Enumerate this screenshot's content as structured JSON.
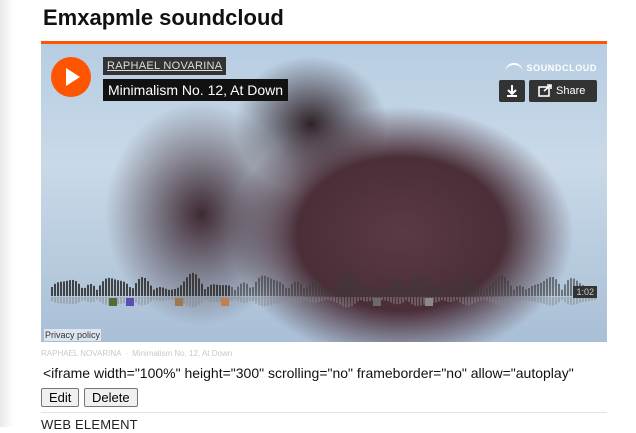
{
  "page": {
    "title": "Emxapmle soundcloud"
  },
  "player": {
    "artist": "RAPHAEL NOVARINA",
    "track": "Minimalism No. 12, At Down",
    "brand": "SOUNDCLOUD",
    "share_label": "Share",
    "duration": "1:02",
    "privacy": "Privacy policy",
    "accent_color": "#ff5500",
    "icons": {
      "play": "play-icon",
      "download": "download-icon",
      "share": "share-icon",
      "logo": "soundcloud-logo-icon"
    }
  },
  "caption": {
    "artist": "RAPHAEL NOVARINA",
    "separator": "·",
    "track": "Minimalism No. 12, At Down"
  },
  "embed_code": "<iframe width=\"100%\" height=\"300\" scrolling=\"no\" frameborder=\"no\" allow=\"autoplay\"",
  "buttons": {
    "edit": "Edit",
    "delete": "Delete"
  },
  "next_section": {
    "heading": "WEB ELEMENT"
  }
}
